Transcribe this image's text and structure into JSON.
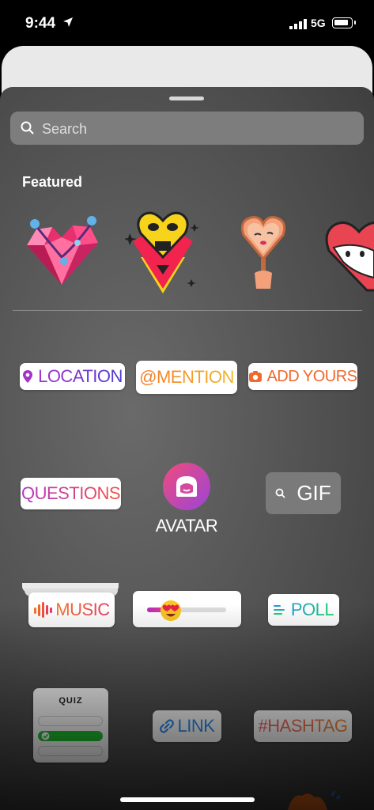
{
  "status_bar": {
    "time": "9:44",
    "network": "5G"
  },
  "search": {
    "placeholder": "Search"
  },
  "featured": {
    "title": "Featured"
  },
  "stickers": {
    "location": "LOCATION",
    "mention": "@MENTION",
    "add_yours": "ADD YOURS",
    "questions": "QUESTIONS",
    "avatar": "AVATAR",
    "gif": "GIF",
    "music": "MUSIC",
    "poll": "POLL",
    "quiz": "QUIZ",
    "link": "LINK",
    "hashtag": "#HASHTAG"
  },
  "slider": {
    "value_fraction": 0.3,
    "emoji": "heart-eyes-emoji"
  },
  "quiz_options": [
    {
      "correct": false
    },
    {
      "correct": true
    },
    {
      "correct": false
    }
  ],
  "colors": {
    "sheet_bg": "#5a5a5a",
    "location": "#a533c9",
    "mention": "#f5792a",
    "poll": "#1c9fd4",
    "link": "#2a8ef0",
    "quiz_correct": "#1ec230"
  },
  "icons": [
    "location-arrow-icon",
    "signal-icon",
    "battery-icon",
    "search-icon",
    "location-pin-icon",
    "camera-icon",
    "avatar-icon",
    "music-bars-icon",
    "poll-lines-icon",
    "link-icon",
    "check-icon"
  ]
}
